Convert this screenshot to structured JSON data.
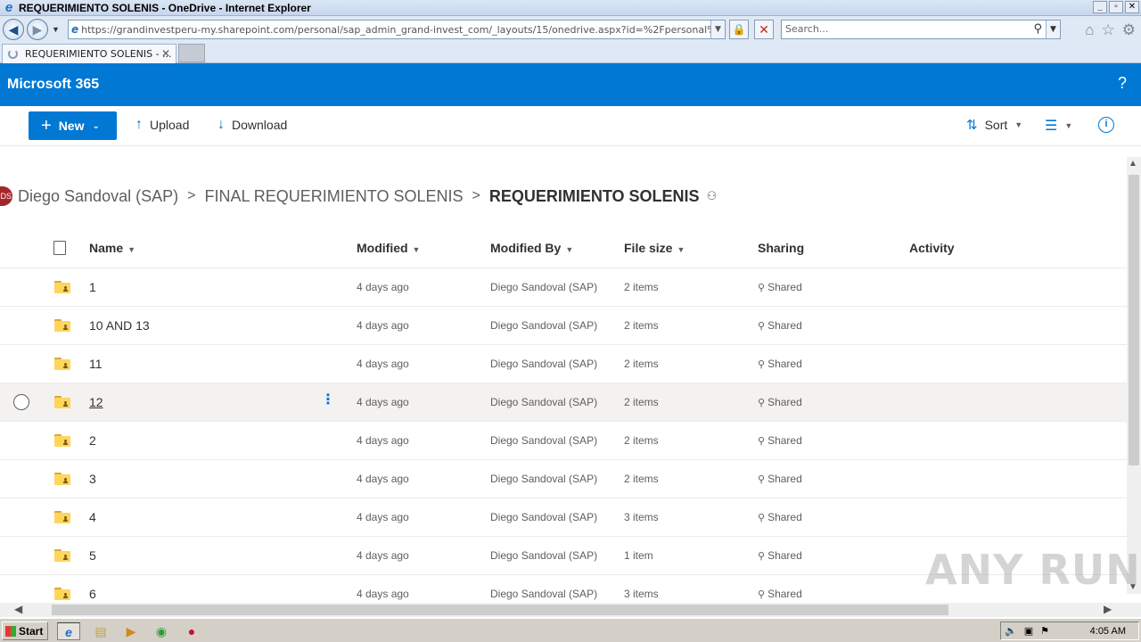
{
  "window": {
    "title": "REQUERIMIENTO SOLENIS - OneDrive - Internet Explorer",
    "min_label": "_",
    "max_label": "▫",
    "close_label": "✕"
  },
  "browser": {
    "url": "https://grandinvestperu-my.sharepoint.com/personal/sap_admin_grand-invest_com/_layouts/15/onedrive.aspx?id=%2Fpersonal%2Fsap%5Fac",
    "search_placeholder": "Search...",
    "tab_title": "REQUERIMIENTO SOLENIS - ...",
    "tab_close": "✕"
  },
  "suite": {
    "brand": "Microsoft 365",
    "help": "?"
  },
  "commands": {
    "new_label": "New",
    "upload_label": "Upload",
    "download_label": "Download",
    "sort_label": "Sort",
    "info_label": "i"
  },
  "breadcrumb": {
    "avatar_initials": "DS",
    "items": [
      "Diego Sandoval (SAP)",
      "FINAL REQUERIMIENTO SOLENIS",
      "REQUERIMIENTO SOLENIS"
    ],
    "separator": ">"
  },
  "columns": {
    "name": "Name",
    "modified": "Modified",
    "modified_by": "Modified By",
    "file_size": "File size",
    "sharing": "Sharing",
    "activity": "Activity"
  },
  "rows": [
    {
      "name": "1",
      "modified": "4 days ago",
      "modified_by": "Diego Sandoval (SAP)",
      "file_size": "2 items",
      "sharing": "Shared"
    },
    {
      "name": "10 AND 13",
      "modified": "4 days ago",
      "modified_by": "Diego Sandoval (SAP)",
      "file_size": "2 items",
      "sharing": "Shared"
    },
    {
      "name": "11",
      "modified": "4 days ago",
      "modified_by": "Diego Sandoval (SAP)",
      "file_size": "2 items",
      "sharing": "Shared"
    },
    {
      "name": "12",
      "modified": "4 days ago",
      "modified_by": "Diego Sandoval (SAP)",
      "file_size": "2 items",
      "sharing": "Shared"
    },
    {
      "name": "2",
      "modified": "4 days ago",
      "modified_by": "Diego Sandoval (SAP)",
      "file_size": "2 items",
      "sharing": "Shared"
    },
    {
      "name": "3",
      "modified": "4 days ago",
      "modified_by": "Diego Sandoval (SAP)",
      "file_size": "2 items",
      "sharing": "Shared"
    },
    {
      "name": "4",
      "modified": "4 days ago",
      "modified_by": "Diego Sandoval (SAP)",
      "file_size": "3 items",
      "sharing": "Shared"
    },
    {
      "name": "5",
      "modified": "4 days ago",
      "modified_by": "Diego Sandoval (SAP)",
      "file_size": "1 item",
      "sharing": "Shared"
    },
    {
      "name": "6",
      "modified": "4 days ago",
      "modified_by": "Diego Sandoval (SAP)",
      "file_size": "3 items",
      "sharing": "Shared"
    }
  ],
  "hovered_row_index": 3,
  "watermark": "ANY RUN",
  "taskbar": {
    "start_label": "Start",
    "clock": "4:05 AM"
  },
  "colors": {
    "brand_blue": "#0078d4",
    "suite_bar": "#0078d4",
    "folder_yellow": "#ffd55c",
    "avatar_red": "#a4262c"
  }
}
